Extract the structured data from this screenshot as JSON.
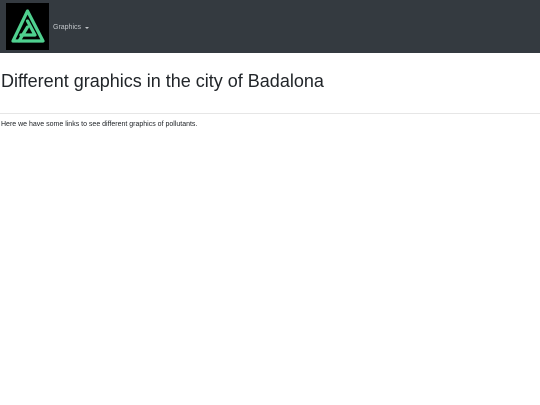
{
  "navbar": {
    "logo_icon": "triangular-a-logo",
    "logo_color": "#4fd08f",
    "background_color": "#343a40",
    "dropdown_label": "Graphics",
    "dropdown_icon": "caret-down-icon"
  },
  "main": {
    "title": "Different graphics in the city of Badalona",
    "intro": "Here we have some links to see different graphics of pollutants."
  }
}
